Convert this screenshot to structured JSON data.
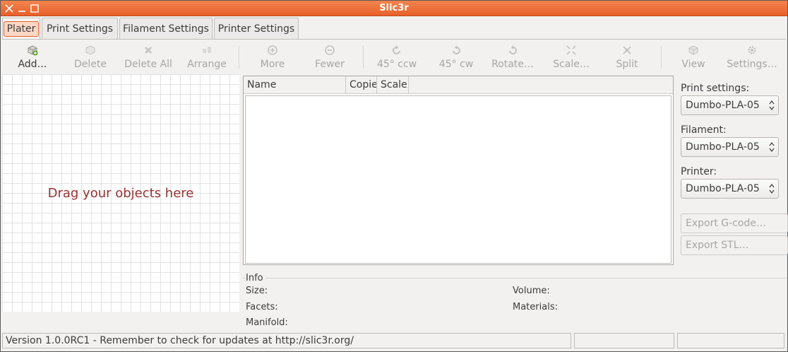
{
  "window": {
    "title": "Slic3r"
  },
  "tabs": [
    {
      "label": "Plater",
      "active": true
    },
    {
      "label": "Print Settings"
    },
    {
      "label": "Filament Settings"
    },
    {
      "label": "Printer Settings"
    }
  ],
  "toolbar": {
    "add": "Add…",
    "delete": "Delete",
    "delete_all": "Delete All",
    "arrange": "Arrange",
    "more": "More",
    "fewer": "Fewer",
    "ccw": "45° ccw",
    "cw": "45° cw",
    "rotate": "Rotate…",
    "scale": "Scale…",
    "split": "Split",
    "view": "View",
    "settings": "Settings…"
  },
  "canvas": {
    "hint": "Drag your objects here"
  },
  "object_list": {
    "columns": [
      "Name",
      "Copie",
      "Scale"
    ],
    "rows": []
  },
  "side_panel": {
    "print_label": "Print settings:",
    "print_value": "Dumbo-PLA-05",
    "filament_label": "Filament:",
    "filament_value": "Dumbo-PLA-05",
    "printer_label": "Printer:",
    "printer_value": "Dumbo-PLA-05",
    "export_gcode": "Export G-code…",
    "export_stl": "Export STL…"
  },
  "info": {
    "title": "Info",
    "size": "Size:",
    "volume": "Volume:",
    "facets": "Facets:",
    "materials": "Materials:",
    "manifold": "Manifold:"
  },
  "status": {
    "text": "Version 1.0.0RC1 - Remember to check for updates at http://slic3r.org/"
  },
  "colors": {
    "titlebar": "#e8602a",
    "hint": "#963232",
    "background": "#f2f1f0"
  }
}
